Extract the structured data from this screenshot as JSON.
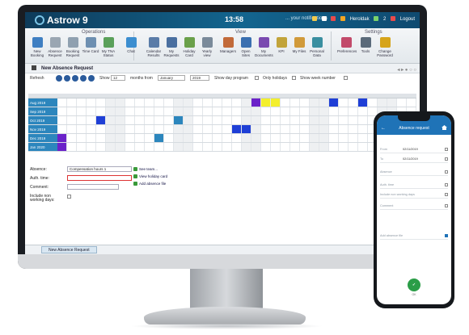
{
  "colors": {
    "accent": "#2c86bd",
    "title_bar": "#13658f",
    "purple": "#6b22c9",
    "blue": "#1f3fd6",
    "yellow": "#f3ef2d",
    "green": "#2a9d47"
  },
  "app": {
    "name": "Astrow 9",
    "time": "13:58",
    "notifications": "... your notifications",
    "user_items": [
      "Heroldak",
      "2",
      "Logout"
    ]
  },
  "ribbon": {
    "groups": [
      "Operations",
      "View",
      "Settings"
    ],
    "buttons": [
      {
        "label": "New Booking",
        "icon": "clock-icon"
      },
      {
        "label": "Absence Request",
        "icon": "document-icon"
      },
      {
        "label": "Booking Request",
        "icon": "document-icon"
      },
      {
        "label": "Time Card",
        "icon": "card-icon"
      },
      {
        "label": "My TNA Status",
        "icon": "clipboard-icon"
      },
      {
        "label": "Chat",
        "icon": "chat-icon"
      },
      {
        "label": "Calendar Results",
        "icon": "calendar-icon"
      },
      {
        "label": "My Requests",
        "icon": "search-icon"
      },
      {
        "label": "Holiday Card",
        "icon": "document-icon"
      },
      {
        "label": "Yearly view",
        "icon": "grid-icon"
      },
      {
        "label": "Managers",
        "icon": "people-icon"
      },
      {
        "label": "Open Sites",
        "icon": "search-icon"
      },
      {
        "label": "My Documents",
        "icon": "person-icon"
      },
      {
        "label": "KPI",
        "icon": "chart-icon"
      },
      {
        "label": "My Files",
        "icon": "folder-icon"
      },
      {
        "label": "Personal Data",
        "icon": "person-icon"
      },
      {
        "label": "Preferences",
        "icon": "palette-icon"
      },
      {
        "label": "Tools",
        "icon": "tools-icon"
      },
      {
        "label": "Change Password",
        "icon": "lock-icon"
      }
    ]
  },
  "page": {
    "title": "New Absence Request"
  },
  "toolbar": {
    "refresh": "Refresh",
    "show": "Show",
    "months_count": "12",
    "months_from": "months from",
    "month": "January",
    "year": "2019",
    "show_day_program": "Show day program",
    "only_holidays": "Only holidays",
    "show_week_number": "Show week number"
  },
  "calendar": {
    "months": [
      "Aug 2019",
      "Sep 2019",
      "Oct 2019",
      "Nov 2019",
      "Dec 2019",
      "Jan 2020"
    ]
  },
  "form": {
    "absence_label": "Absence:",
    "absence_value": "Compensation hours 1",
    "auth_time_label": "Auth. time:",
    "comment_label": "Comment:",
    "include_label": "Include non working days:",
    "links": [
      "See team...",
      "View holiday card",
      "Add absence file"
    ]
  },
  "bottom_tab": "New Absence Request",
  "phone": {
    "title": "Absence request",
    "rows": [
      {
        "label": "From",
        "value": "02/11/2019"
      },
      {
        "label": "To",
        "value": "02/11/2019"
      },
      {
        "label": "Absence",
        "value": ""
      },
      {
        "label": "Auth. time",
        "value": ""
      },
      {
        "label": "Include non working days",
        "value": ""
      },
      {
        "label": "Comment",
        "value": ""
      }
    ],
    "attach_label": "Add absence file",
    "fab_label": "OK"
  }
}
